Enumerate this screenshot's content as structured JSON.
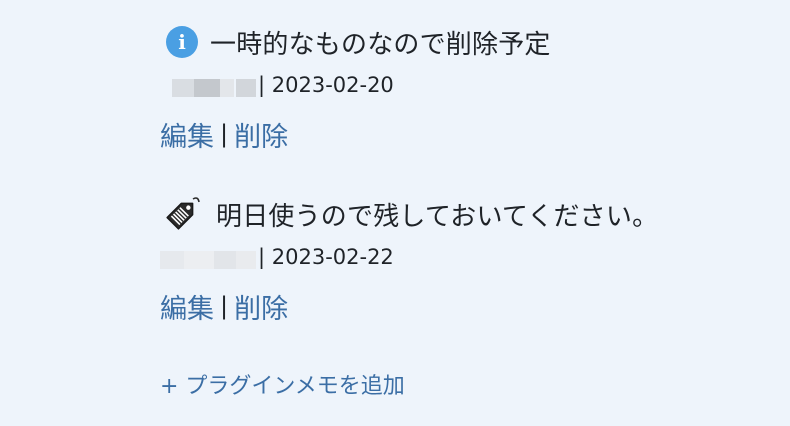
{
  "notes": [
    {
      "icon": "info-icon",
      "text": "一時的なものなので削除予定",
      "date": "| 2023-02-20",
      "edit_label": "編集",
      "separator": "|",
      "delete_label": "削除"
    },
    {
      "icon": "price-tag-icon",
      "text": "明日使うので残しておいてください。",
      "date": "| 2023-02-22",
      "edit_label": "編集",
      "separator": "|",
      "delete_label": "削除"
    }
  ],
  "add_note_label": "+ プラグインメモを追加",
  "colors": {
    "background": "#eef4fb",
    "link": "#3b6ea5",
    "info_icon": "#4a9fe3",
    "text": "#1f2328"
  }
}
